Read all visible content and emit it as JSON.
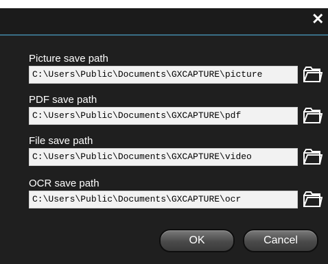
{
  "dialog": {
    "close_glyph": "✕",
    "rows": [
      {
        "label": "Picture save path",
        "value": "C:\\Users\\Public\\Documents\\GXCAPTURE\\picture"
      },
      {
        "label": "PDF save path",
        "value": "C:\\Users\\Public\\Documents\\GXCAPTURE\\pdf"
      },
      {
        "label": "File save path",
        "value": "C:\\Users\\Public\\Documents\\GXCAPTURE\\video"
      },
      {
        "label": "OCR save path",
        "value": "C:\\Users\\Public\\Documents\\GXCAPTURE\\ocr"
      }
    ],
    "ok_label": "OK",
    "cancel_label": "Cancel"
  },
  "icons": {
    "close": "close-icon",
    "folder": "folder-icon"
  },
  "colors": {
    "background": "#1f1f1f",
    "title_border": "#3a6f87",
    "field_bg": "#f2f2f2"
  }
}
